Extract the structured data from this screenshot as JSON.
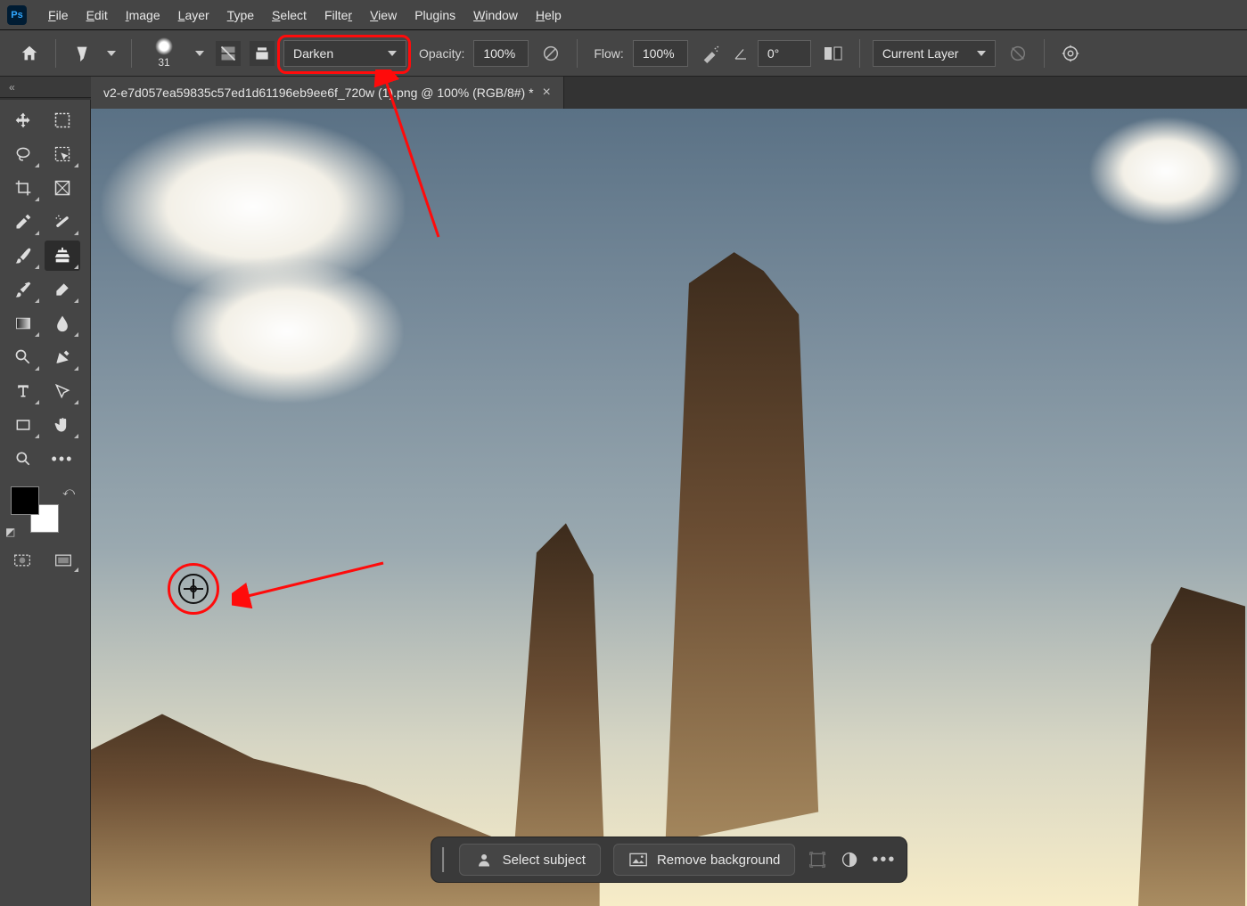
{
  "app": {
    "logo_text": "Ps"
  },
  "menu": {
    "file": "File",
    "edit": "Edit",
    "image": "Image",
    "layer": "Layer",
    "type": "Type",
    "select": "Select",
    "filter": "Filter",
    "view": "View",
    "plugins": "Plugins",
    "window": "Window",
    "help": "Help"
  },
  "options": {
    "brush_size": "31",
    "mode_value": "Darken",
    "opacity_label": "Opacity:",
    "opacity_value": "100%",
    "flow_label": "Flow:",
    "flow_value": "100%",
    "angle_value": "0°",
    "sample_value": "Current Layer"
  },
  "collapse_hint": "«",
  "document": {
    "tab_title": "v2-e7d057ea59835c57ed1d61196eb9ee6f_720w (1).png @ 100% (RGB/8#) *"
  },
  "context_bar": {
    "select_subject": "Select subject",
    "remove_bg": "Remove background"
  }
}
